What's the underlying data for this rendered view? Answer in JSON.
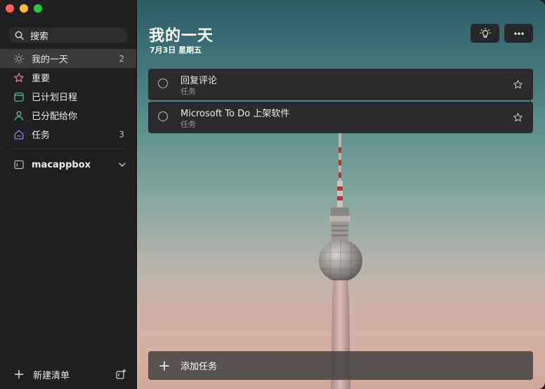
{
  "sidebar": {
    "search_label": "搜索",
    "items": [
      {
        "label": "我的一天",
        "count": "2",
        "icon": "sun-icon",
        "color": "#9a9a9a"
      },
      {
        "label": "重要",
        "count": "",
        "icon": "star-icon",
        "color": "#e77c9e"
      },
      {
        "label": "已计划日程",
        "count": "",
        "icon": "calendar-icon",
        "color": "#60c0a6"
      },
      {
        "label": "已分配给你",
        "count": "",
        "icon": "person-icon",
        "color": "#6ccf9c"
      },
      {
        "label": "任务",
        "count": "3",
        "icon": "home-icon",
        "color": "#8a8ef0"
      }
    ],
    "group": {
      "label": "macappbox",
      "icon": "list-group-icon"
    },
    "new_list_label": "新建清单"
  },
  "main": {
    "title": "我的一天",
    "date": "7月3日 星期五",
    "tasks": [
      {
        "title": "回复评论",
        "sub": "任务"
      },
      {
        "title": "Microsoft To Do 上架软件",
        "sub": "任务"
      }
    ],
    "add_task_label": "添加任务"
  }
}
